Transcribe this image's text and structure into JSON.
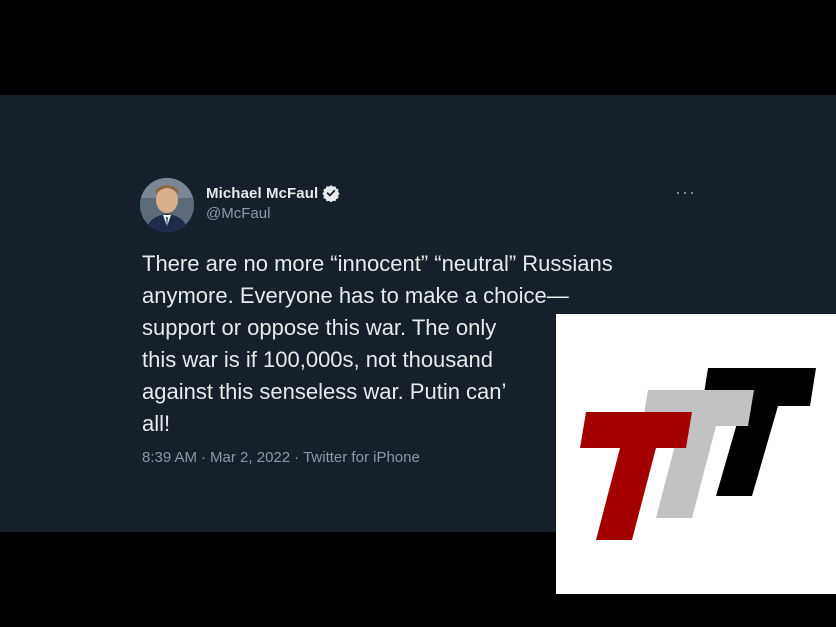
{
  "tweet": {
    "author_name": "Michael McFaul",
    "author_handle": "@McFaul",
    "more_label": "···",
    "text": "There are no more “innocent” “neutral” Russians anymore. Everyone has to make a choice— support or oppose this war. The only way to end this war is if 100,000s, not thousands, protest against this senseless war. Putin can’t arrest them all!",
    "visible_lines": [
      "There are no more “innocent” “neutral” Russians",
      "anymore. Everyone has to make a choice—",
      "support or oppose this war. The only",
      "this war is if 100,000s, not thousand",
      "against this senseless war. Putin can’",
      "all!"
    ],
    "time": "8:39 AM",
    "date": "Mar 2, 2022",
    "source": "Twitter for iPhone",
    "separator": "·"
  },
  "logo": {
    "icon_name": "ttt-logo",
    "colors": [
      "#a50000",
      "#c2c2c2",
      "#000000"
    ]
  },
  "colors": {
    "background": "#15202b",
    "text": "#e7e9ea",
    "muted": "#8b98a5",
    "verified": "#e7e9ea"
  }
}
